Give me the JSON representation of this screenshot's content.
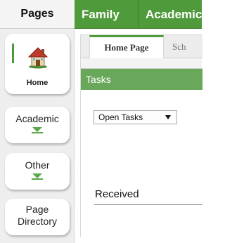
{
  "left_nav": {
    "header": "Pages",
    "items": [
      {
        "label": "Home",
        "icon": "house-icon"
      },
      {
        "label": "Academic",
        "icon": "chevron-down-icon"
      },
      {
        "label": "Other",
        "icon": "chevron-down-icon"
      },
      {
        "label_line1": "Page",
        "label_line2": "Directory"
      }
    ]
  },
  "top_tabs": [
    "Family",
    "Academics"
  ],
  "sub_tabs": [
    "Home Page",
    "Sch"
  ],
  "tasks": {
    "title": "Tasks",
    "filter_value": "Open Tasks",
    "received_label": "Received"
  },
  "colors": {
    "accent_green": "#4f9b3c",
    "panel_green": "#69a75a",
    "house_roof": "#c0392b"
  }
}
